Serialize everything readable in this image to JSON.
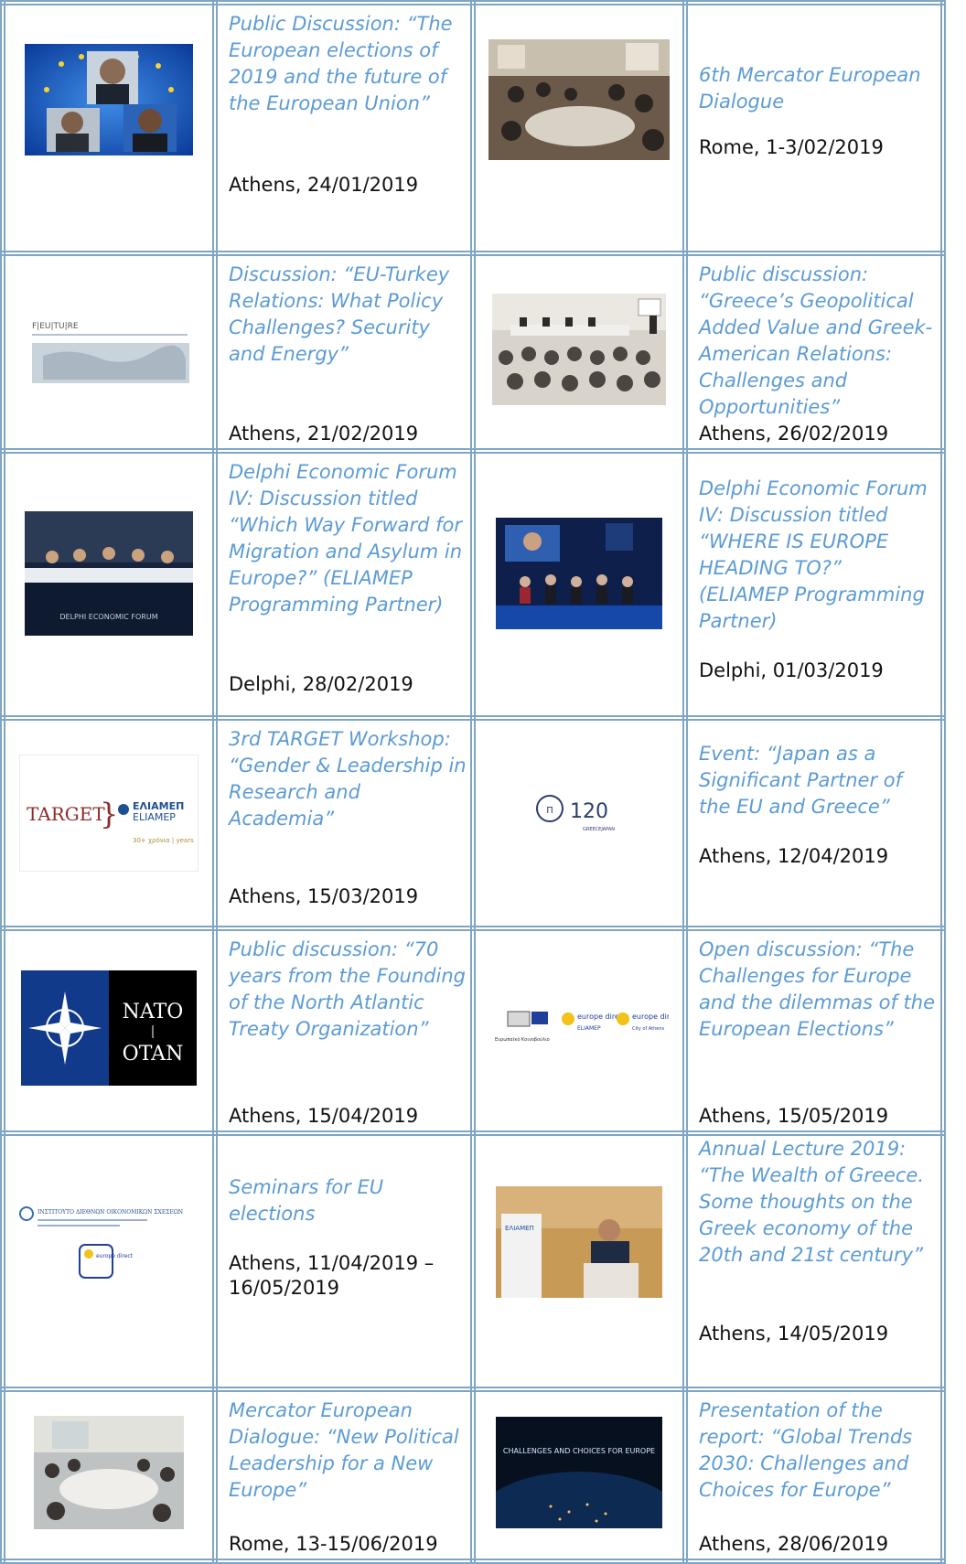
{
  "events": [
    {
      "left": {
        "image": {
          "name": "eu-flag-speakers-photo",
          "caption": ""
        },
        "title": "Public Discussion: “The European elections of 2019 and the future of the European Union”",
        "place_date": "Athens, 24/01/2019"
      },
      "right": {
        "image": {
          "name": "conference-room-photo"
        },
        "title": "6th Mercator European Dialogue",
        "place_date": "Rome, 1-3/02/2019"
      }
    },
    {
      "left": {
        "image": {
          "name": "feuture-logo-map",
          "text": "F|EU|TU|RE"
        },
        "title": "Discussion: “EU-Turkey Relations: What Policy Challenges? Security and Energy”",
        "place_date": "Athens, 21/02/2019"
      },
      "right": {
        "image": {
          "name": "panel-audience-photo"
        },
        "title": "Public discussion: “Greece’s Geopolitical Added Value and Greek-American Relations: Challenges and Opportunities”",
        "place_date": "Athens, 26/02/2019"
      }
    },
    {
      "left": {
        "image": {
          "name": "delphi-panel-photo",
          "text": "DELPHI ECONOMIC FORUM"
        },
        "title": "Delphi Economic Forum IV: Discussion titled “Which Way Forward for Migration and Asylum in Europe?” (ELIAMEP Programming Partner)",
        "place_date": "Delphi, 28/02/2019"
      },
      "right": {
        "image": {
          "name": "delphi-stage-photo"
        },
        "title": "Delphi Economic Forum IV: Discussion titled “WHERE IS EUROPE HEADING TO?” (ELIAMEP Programming Partner)",
        "place_date": "Delphi, 01/03/2019"
      }
    },
    {
      "left": {
        "image": {
          "name": "target-eliamep-logo",
          "text_target": "TARGET",
          "text_gr": "ΕΛΙΑΜΕΠ",
          "text_en": "ELIAMEP",
          "text_years": "30+ χρόνια | years"
        },
        "title": "3rd TARGET Workshop: “Gender & Leadership in Research and Academia”",
        "place_date": "Athens, 15/03/2019"
      },
      "right": {
        "image": {
          "name": "greece-japan-120-logo",
          "text": "120",
          "subtext": "GREECEJAPAN"
        },
        "title": "Event: “Japan as a Significant Partner of the EU and Greece”",
        "place_date": "Athens, 12/04/2019"
      }
    },
    {
      "left": {
        "image": {
          "name": "nato-otan-logo",
          "text_top": "NATO",
          "text_bottom": "OTAN"
        },
        "title": "Public discussion: “70 years from the Founding of the North Atlantic Treaty Organization”",
        "place_date": "Athens, 15/04/2019"
      },
      "right": {
        "image": {
          "name": "europe-direct-logos",
          "text_ep": "Ευρωπαϊκό Κοινοβούλιο",
          "text_ed1": "europe direct",
          "text_ed1b": "ELIAMEP",
          "text_ed2": "europe direct",
          "text_ed2b": "City of Athens"
        },
        "title": "Open discussion: “The Challenges for Europe and the dilemmas of the European Elections”",
        "place_date": "Athens, 15/05/2019"
      }
    },
    {
      "left": {
        "image": {
          "name": "iies-europe-direct-logo",
          "text_inst": "ΙΝΣΤΙΤΟΥΤΟ ΔΙΕΘΝΩΝ ΟΙΚΟΝΟΜΙΚΩΝ ΣΧΕΣΕΩΝ",
          "text_ed": "europe direct"
        },
        "title": "Seminars for EU elections",
        "place_date": "Athens, 11/04/2019 – 16/05/2019"
      },
      "right": {
        "image": {
          "name": "annual-lecture-photo",
          "text": "ΕΛΙΑΜΕΠ"
        },
        "title": "Annual Lecture 2019: “The Wealth of Greece. Some thoughts on the Greek economy of the 20th and 21st century”",
        "place_date": "Athens, 14/05/2019"
      }
    },
    {
      "left": {
        "image": {
          "name": "seminar-room-photo"
        },
        "title": "Mercator European Dialogue: “New Political Leadership for a New Europe”",
        "place_date": "Rome, 13-15/06/2019"
      },
      "right": {
        "image": {
          "name": "global-trends-report-cover",
          "text": "CHALLENGES AND CHOICES FOR EUROPE"
        },
        "title": "Presentation of the report: “Global Trends 2030: Challenges and Choices for Europe”",
        "place_date": "Athens, 28/06/2019"
      }
    }
  ]
}
